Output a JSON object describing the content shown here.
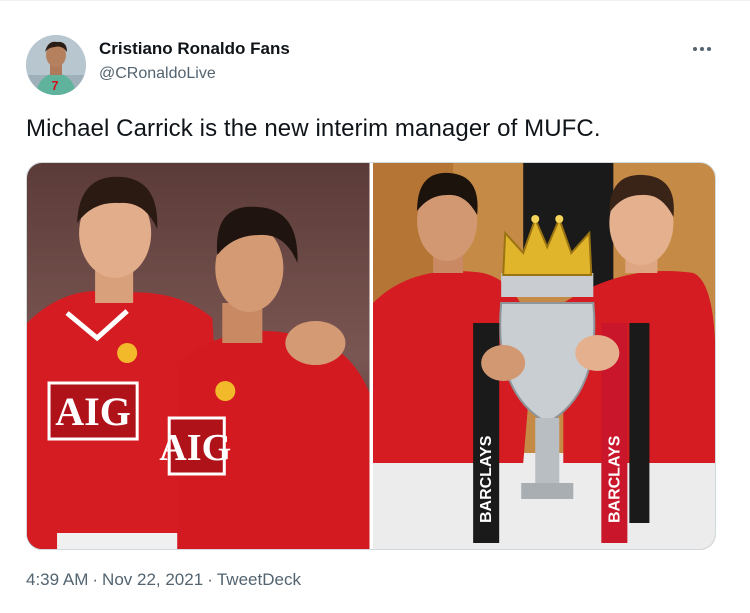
{
  "user": {
    "display_name": "Cristiano Ronaldo Fans",
    "handle": "@CRonaldoLive",
    "avatar_jersey_number": "7"
  },
  "tweet": {
    "text": "Michael Carrick is the new interim manager of MUFC."
  },
  "media": {
    "left_photo": {
      "sponsor": "AIG",
      "sponsor_partial": "AIG"
    },
    "right_photo": {
      "ribbon_text": "BARCLAYS"
    }
  },
  "meta": {
    "time": "4:39 AM",
    "separator": "·",
    "date": "Nov 22, 2021",
    "source": "TweetDeck"
  },
  "icons": {
    "more": "more-horizontal-icon"
  },
  "colors": {
    "text_primary": "#0f1419",
    "text_secondary": "#536471",
    "united_red": "#d2121c",
    "trophy_gold": "#e0b52b"
  }
}
